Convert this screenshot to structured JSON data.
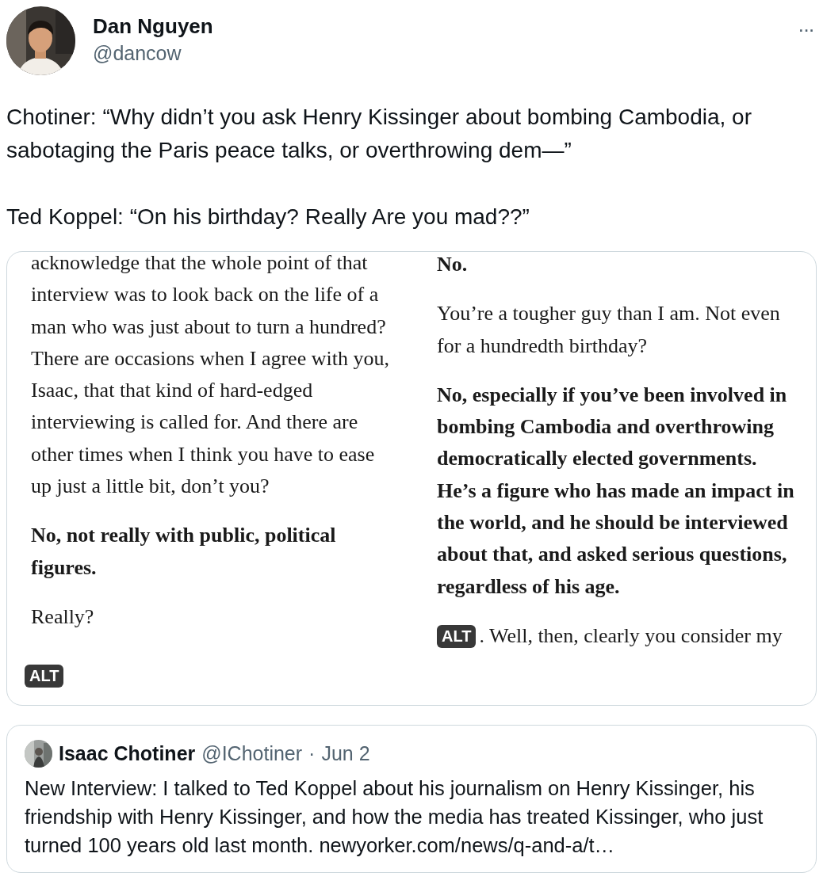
{
  "author": {
    "name": "Dan Nguyen",
    "handle": "@dancow"
  },
  "more_label": "···",
  "text": [
    "Chotiner: “Why didn’t you ask Henry Kissinger about bombing Cambodia, or sabotaging the Paris peace talks, or overthrowing dem—”",
    "Ted Koppel: “On his birthday? Really Are you mad??”"
  ],
  "media": [
    {
      "alt_badge": "ALT",
      "paragraphs": [
        {
          "text": "acknowledge that the whole point of that interview was to look back on the life of a man who was just about to turn a hundred? There are occasions when I agree with you, Isaac, that that kind of hard-edged interviewing is called for. And there are other times when I think you have to ease up just a little bit, don’t you?",
          "bold": false
        },
        {
          "text": "No, not really with public, political figures.",
          "bold": true
        },
        {
          "text": "Really?",
          "bold": false
        }
      ]
    },
    {
      "alt_badge": "ALT",
      "paragraphs": [
        {
          "text": "No.",
          "bold": true
        },
        {
          "text": "You’re a tougher guy than I am. Not even for a hundredth birthday?",
          "bold": false
        },
        {
          "text": "No, especially if you’ve been involved in bombing Cambodia and overthrowing democratically elected governments. He’s a figure who has made an impact in the world, and he should be interviewed about that, and asked serious questions, regardless of his age.",
          "bold": true
        },
        {
          "text": ". Well, then, clearly you consider my",
          "bold": false
        }
      ]
    }
  ],
  "quote": {
    "name": "Isaac Chotiner",
    "handle": "@IChotiner",
    "separator": "·",
    "date": "Jun 2",
    "text": "New Interview: I talked to Ted Koppel about his journalism on Henry Kissinger, his friendship with Henry Kissinger, and how the media has treated Kissinger, who just turned 100 years old last month. newyorker.com/news/q-and-a/t…"
  }
}
